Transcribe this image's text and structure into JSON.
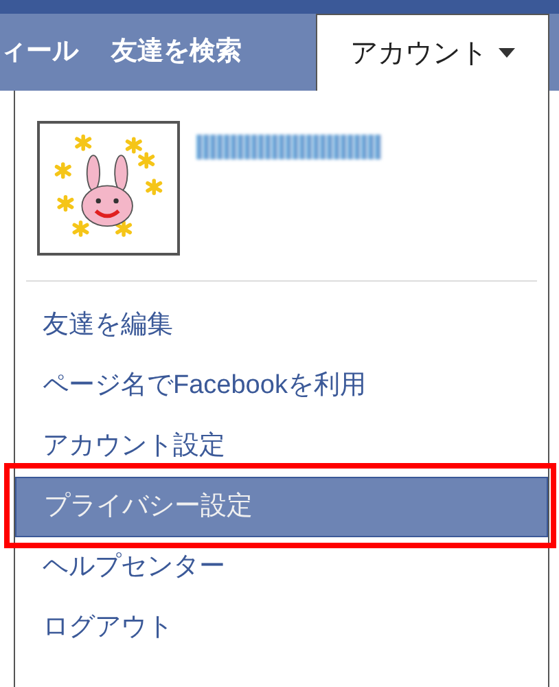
{
  "nav_tabs": [
    {
      "label": "ィール",
      "selected": false
    },
    {
      "label": "友達を検索",
      "selected": false
    },
    {
      "label": "アカウント",
      "selected": true
    }
  ],
  "menu_items": [
    {
      "label": "友達を編集",
      "selected": false
    },
    {
      "label": "ページ名でFacebookを利用",
      "selected": false
    },
    {
      "label": "アカウント設定",
      "selected": false
    },
    {
      "label": "プライバシー設定",
      "selected": true,
      "annotated": true
    },
    {
      "label": "ヘルプセンター",
      "selected": false
    },
    {
      "label": "ログアウト",
      "selected": false
    }
  ]
}
